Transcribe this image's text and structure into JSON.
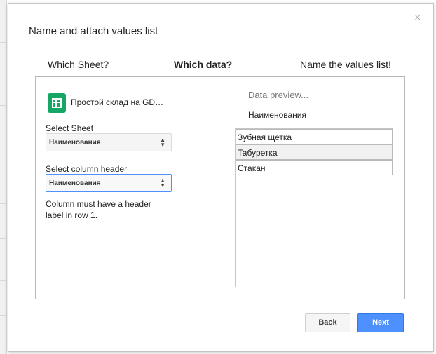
{
  "dialog": {
    "title": "Name and attach values list",
    "close_glyph": "×"
  },
  "steps": [
    {
      "label": "Which Sheet?"
    },
    {
      "label": "Which data?"
    },
    {
      "label": "Name the values list!"
    }
  ],
  "left_panel": {
    "spreadsheet_name": "Простой склад на GD…",
    "select_sheet_label": "Select Sheet",
    "select_sheet_value": "Наименования",
    "select_column_label": "Select column header",
    "select_column_value": "Наименования",
    "help_text": "Column must have a header label in row 1."
  },
  "preview": {
    "title": "Data preview...",
    "column_name": "Наименования",
    "rows": [
      "Зубная щетка",
      "Табуретка",
      "Стакан"
    ]
  },
  "buttons": {
    "back": "Back",
    "next": "Next"
  },
  "colors": {
    "accent": "#4d90fe",
    "sheets_green": "#16a765"
  },
  "icons": {
    "close": "close-icon",
    "spreadsheet": "google-sheets-icon",
    "select_arrows": "updown-arrows-icon"
  }
}
